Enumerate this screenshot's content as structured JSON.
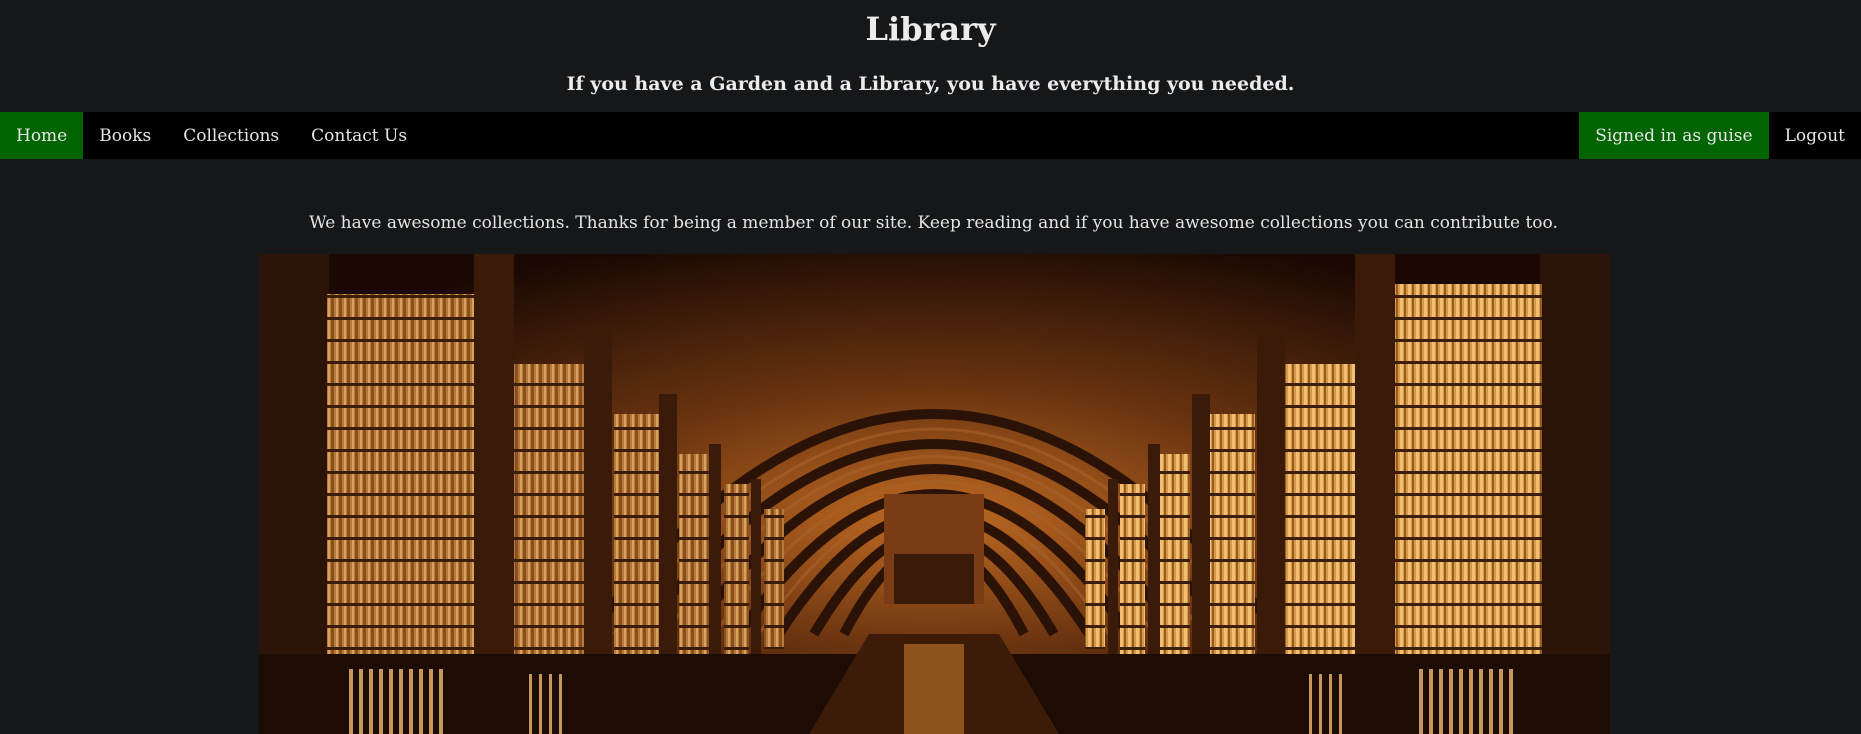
{
  "header": {
    "title": "Library",
    "tagline": "If you have a Garden and a Library, you have everything you needed."
  },
  "nav": {
    "items": [
      {
        "label": "Home",
        "active": true
      },
      {
        "label": "Books",
        "active": false
      },
      {
        "label": "Collections",
        "active": false
      },
      {
        "label": "Contact Us",
        "active": false
      }
    ],
    "user_label": "Signed in as guise",
    "logout_label": "Logout"
  },
  "main": {
    "intro": "We have awesome collections. Thanks for being a member of our site. Keep reading and if you have awesome collections you can contribute too."
  },
  "colors": {
    "background": "#161719",
    "navbar": "#000000",
    "active_green": "#006400"
  }
}
